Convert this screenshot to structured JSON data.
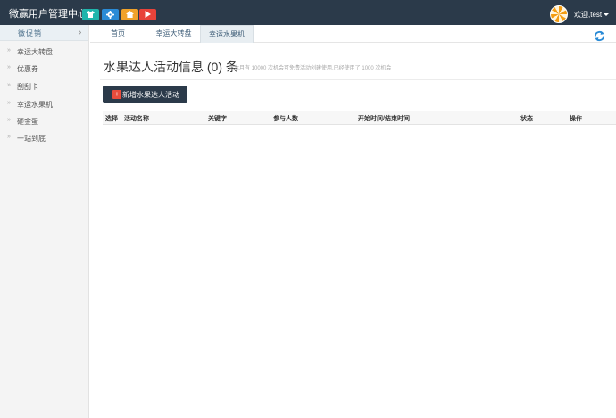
{
  "header": {
    "brand": "微赢用户管理中心",
    "quick_buttons": [
      {
        "icon": "shirt-icon",
        "color": "#1fb5ac"
      },
      {
        "icon": "gear-icon",
        "color": "#2a8bd6"
      },
      {
        "icon": "home-icon",
        "color": "#f0a22a"
      },
      {
        "icon": "play-icon",
        "color": "#e8433a"
      }
    ],
    "user_label": "欢迎,test"
  },
  "sidebar": {
    "heading": "微促销",
    "items": [
      {
        "label": "幸运大转盘"
      },
      {
        "label": "优惠券"
      },
      {
        "label": "刮刮卡"
      },
      {
        "label": "幸运水果机"
      },
      {
        "label": "砸金蛋"
      },
      {
        "label": "一站到底"
      }
    ]
  },
  "tabs": [
    {
      "label": "首页",
      "active": false
    },
    {
      "label": "幸运大转盘",
      "active": false
    },
    {
      "label": "幸运水果机",
      "active": true
    }
  ],
  "main": {
    "title": "水果达人活动信息 (0) 条",
    "note": "你本月有 10000 次机会可免费活动创建使用,已经使用了 1000 次机会",
    "add_button": "新增水果达人活动",
    "table_headers": [
      "选择",
      "活动名称",
      "关键字",
      "参与人数",
      "开始时间/结束时间",
      "状态",
      "操作"
    ]
  },
  "colors": {
    "topbar": "#2b3a4a",
    "accent": "#2b3a4a",
    "danger": "#e74c3c",
    "refresh": "#2a8bd6"
  }
}
